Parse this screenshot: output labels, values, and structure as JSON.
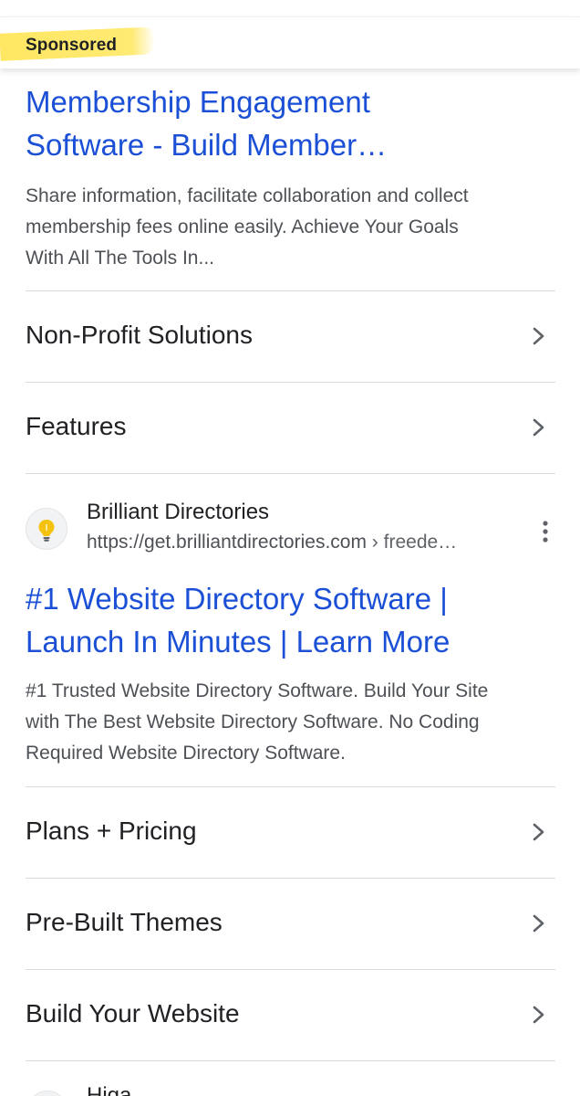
{
  "sponsored_label": "Sponsored",
  "ad1": {
    "title_line1": "Membership Engagement",
    "title_line2": "Software - Build Member…",
    "desc_line1": "Share information, facilitate collaboration and collect",
    "desc_line2": "membership fees online easily. Achieve Your Goals",
    "desc_line3": "With All The Tools In...",
    "sitelinks": [
      {
        "label": "Non-Profit Solutions"
      },
      {
        "label": "Features"
      }
    ]
  },
  "ad2": {
    "site_name": "Brilliant Directories",
    "url": "https://get.brilliantdirectories.com",
    "url_crumb": " › freede…",
    "favicon": "lightbulb-icon",
    "title_line1": "#1 Website Directory Software |",
    "title_line2": "Launch In Minutes | Learn More",
    "desc_line1": "#1 Trusted Website Directory Software. Build Your Site",
    "desc_line2": "with The Best Website Directory Software. No Coding",
    "desc_line3": "Required Website Directory Software.",
    "sitelinks": [
      {
        "label": "Plans + Pricing"
      },
      {
        "label": "Pre-Built Themes"
      },
      {
        "label": "Build Your Website"
      }
    ]
  },
  "next_result": {
    "site_name": "Higa..."
  },
  "colors": {
    "link_blue": "#1a4fd6",
    "highlight": "#ffe65a",
    "divider": "#dadce0"
  }
}
